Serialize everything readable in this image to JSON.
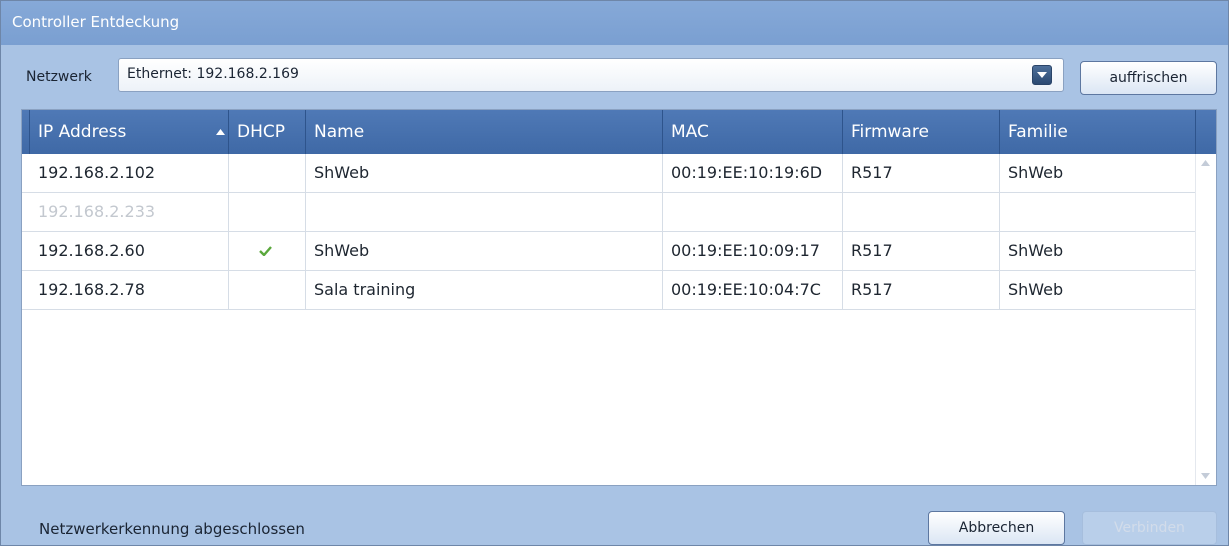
{
  "window": {
    "title": "Controller Entdeckung"
  },
  "network": {
    "label": "Netzwerk",
    "selected": "Ethernet: 192.168.2.169",
    "refresh_label": "auffrischen"
  },
  "table": {
    "columns": [
      "IP Address",
      "DHCP",
      "Name",
      "MAC",
      "Firmware",
      "Familie"
    ],
    "sorted_column": "IP Address",
    "sort_direction": "ascending",
    "rows": [
      {
        "ip": "192.168.2.102",
        "dhcp": false,
        "name": "ShWeb",
        "mac": "00:19:EE:10:19:6D",
        "firmware": "R517",
        "family": "ShWeb",
        "disabled": false
      },
      {
        "ip": "192.168.2.233",
        "dhcp": false,
        "name": "",
        "mac": "",
        "firmware": "",
        "family": "",
        "disabled": true
      },
      {
        "ip": "192.168.2.60",
        "dhcp": true,
        "name": "ShWeb",
        "mac": "00:19:EE:10:09:17",
        "firmware": "R517",
        "family": "ShWeb",
        "disabled": false
      },
      {
        "ip": "192.168.2.78",
        "dhcp": false,
        "name": "Sala training",
        "mac": "00:19:EE:10:04:7C",
        "firmware": "R517",
        "family": "ShWeb",
        "disabled": false
      }
    ]
  },
  "footer": {
    "status": "Netzwerkerkennung abgeschlossen",
    "cancel_label": "Abbrechen",
    "connect_label": "Verbinden",
    "connect_enabled": false
  },
  "colors": {
    "header_blue": "#4a74b2",
    "window_bg": "#a9c3e4",
    "check_green": "#5aa83c"
  },
  "icons": {
    "combo": "chevron-down-icon",
    "sort": "sort-ascending-icon",
    "dhcp": "checkmark-icon",
    "scroll_up": "scroll-up-arrow-icon",
    "scroll_down": "scroll-down-arrow-icon"
  }
}
